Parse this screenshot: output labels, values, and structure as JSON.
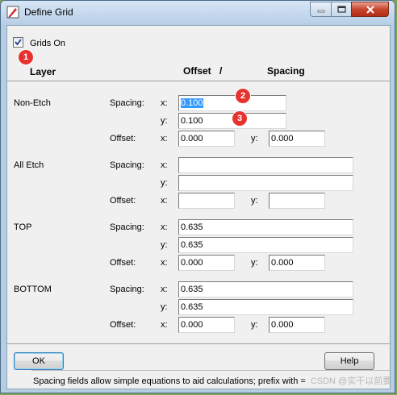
{
  "window": {
    "title": "Define Grid",
    "controls": {
      "minimize": "minimize",
      "maximize": "maximize",
      "close": "close"
    }
  },
  "grids_on": {
    "label": "Grids On",
    "checked": true
  },
  "headers": {
    "layer": "Layer",
    "offset": "Offset",
    "slash": "/",
    "spacing": "Spacing"
  },
  "annotations": [
    "1",
    "2",
    "3"
  ],
  "field_labels": {
    "spacing": "Spacing:",
    "offset": "Offset:",
    "x": "x:",
    "y": "y:"
  },
  "layers": [
    {
      "name": "Non-Etch",
      "spacing_x": "0.100",
      "spacing_y": "0.100",
      "offset_x": "0.000",
      "offset_y": "0.000"
    },
    {
      "name": "All Etch",
      "spacing_x": "",
      "spacing_y": "",
      "offset_x": "",
      "offset_y": ""
    },
    {
      "name": "TOP",
      "spacing_x": "0.635",
      "spacing_y": "0.635",
      "offset_x": "0.000",
      "offset_y": "0.000"
    },
    {
      "name": "BOTTOM",
      "spacing_x": "0.635",
      "spacing_y": "0.635",
      "offset_x": "0.000",
      "offset_y": "0.000"
    }
  ],
  "buttons": {
    "ok": "OK",
    "help": "Help"
  },
  "status_text": "Spacing fields allow simple equations to aid calculations; prefix with =",
  "watermark": "CSDN @实干以前要 成本来"
}
